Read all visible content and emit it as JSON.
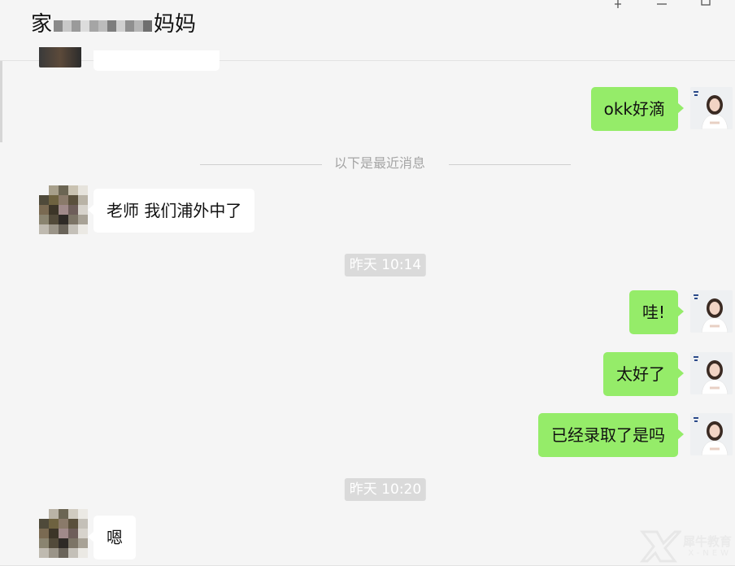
{
  "header": {
    "title_first": "家",
    "title_last": "妈妈",
    "title_blur_colors": [
      "#8a8a8a",
      "#b5b5b5",
      "#d0d0d0",
      "#9a9a9a",
      "#c8c8c8",
      "#a5a5a5",
      "#dcdcdc",
      "#8f8f8f",
      "#bcbcbc",
      "#7d7d7d",
      "#cfcfcf"
    ],
    "pin_icon": "pin-icon",
    "minimize_icon": "minimize-icon",
    "maximize_icon": "maximize-icon"
  },
  "chat": {
    "divider_text": "以下是最近消息",
    "messages": [
      {
        "sender": "me",
        "text": "okk好滴"
      },
      {
        "sender": "other",
        "text": "老师 我们浦外中了"
      },
      {
        "sender": "time",
        "text": "昨天 10:14"
      },
      {
        "sender": "me",
        "text": "哇!"
      },
      {
        "sender": "me",
        "text": "太好了"
      },
      {
        "sender": "me",
        "text": "已经录取了是吗"
      },
      {
        "sender": "time",
        "text": "昨天 10:20"
      },
      {
        "sender": "other",
        "text": "嗯"
      }
    ]
  },
  "watermark": {
    "brand_cn": "犀牛教育",
    "brand_en": "X-NEW"
  },
  "colors": {
    "my_bubble": "#95ec69",
    "other_bubble": "#ffffff",
    "background": "#f5f5f5",
    "timestamp_bg": "#dadada"
  }
}
